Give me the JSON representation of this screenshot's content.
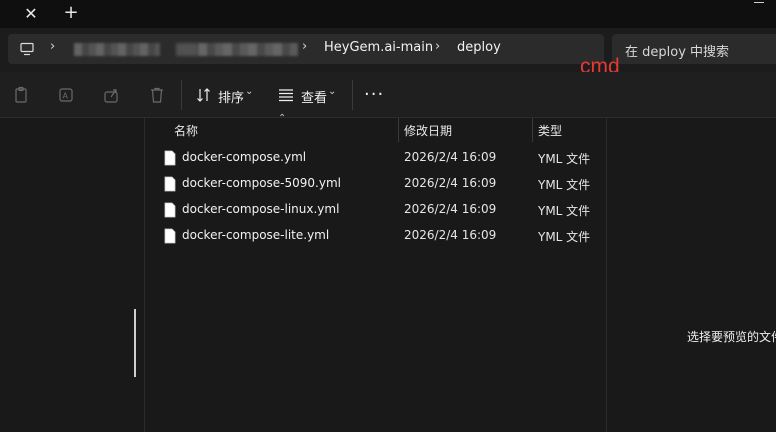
{
  "titlebar": {
    "close_glyph": "✕",
    "new_tab_glyph": "+"
  },
  "address": {
    "separator": "›",
    "crumbs": [
      "HeyGem.ai-main",
      "deploy"
    ],
    "search_placeholder": "在 deploy 中搜索"
  },
  "annotation": {
    "text": "cmd",
    "color": "#e53935"
  },
  "toolbar": {
    "sort_label": "排序",
    "view_label": "查看",
    "caret": "⌄",
    "more_glyph": "···"
  },
  "columns": {
    "name": "名称",
    "modified": "修改日期",
    "type": "类型",
    "sort_indicator": "⌃"
  },
  "files": [
    {
      "name": "docker-compose.yml",
      "modified": "2026/2/4 16:09",
      "type": "YML 文件"
    },
    {
      "name": "docker-compose-5090.yml",
      "modified": "2026/2/4 16:09",
      "type": "YML 文件"
    },
    {
      "name": "docker-compose-linux.yml",
      "modified": "2026/2/4 16:09",
      "type": "YML 文件"
    },
    {
      "name": "docker-compose-lite.yml",
      "modified": "2026/2/4 16:09",
      "type": "YML 文件"
    }
  ],
  "preview": {
    "text": "选择要预览的文件"
  }
}
